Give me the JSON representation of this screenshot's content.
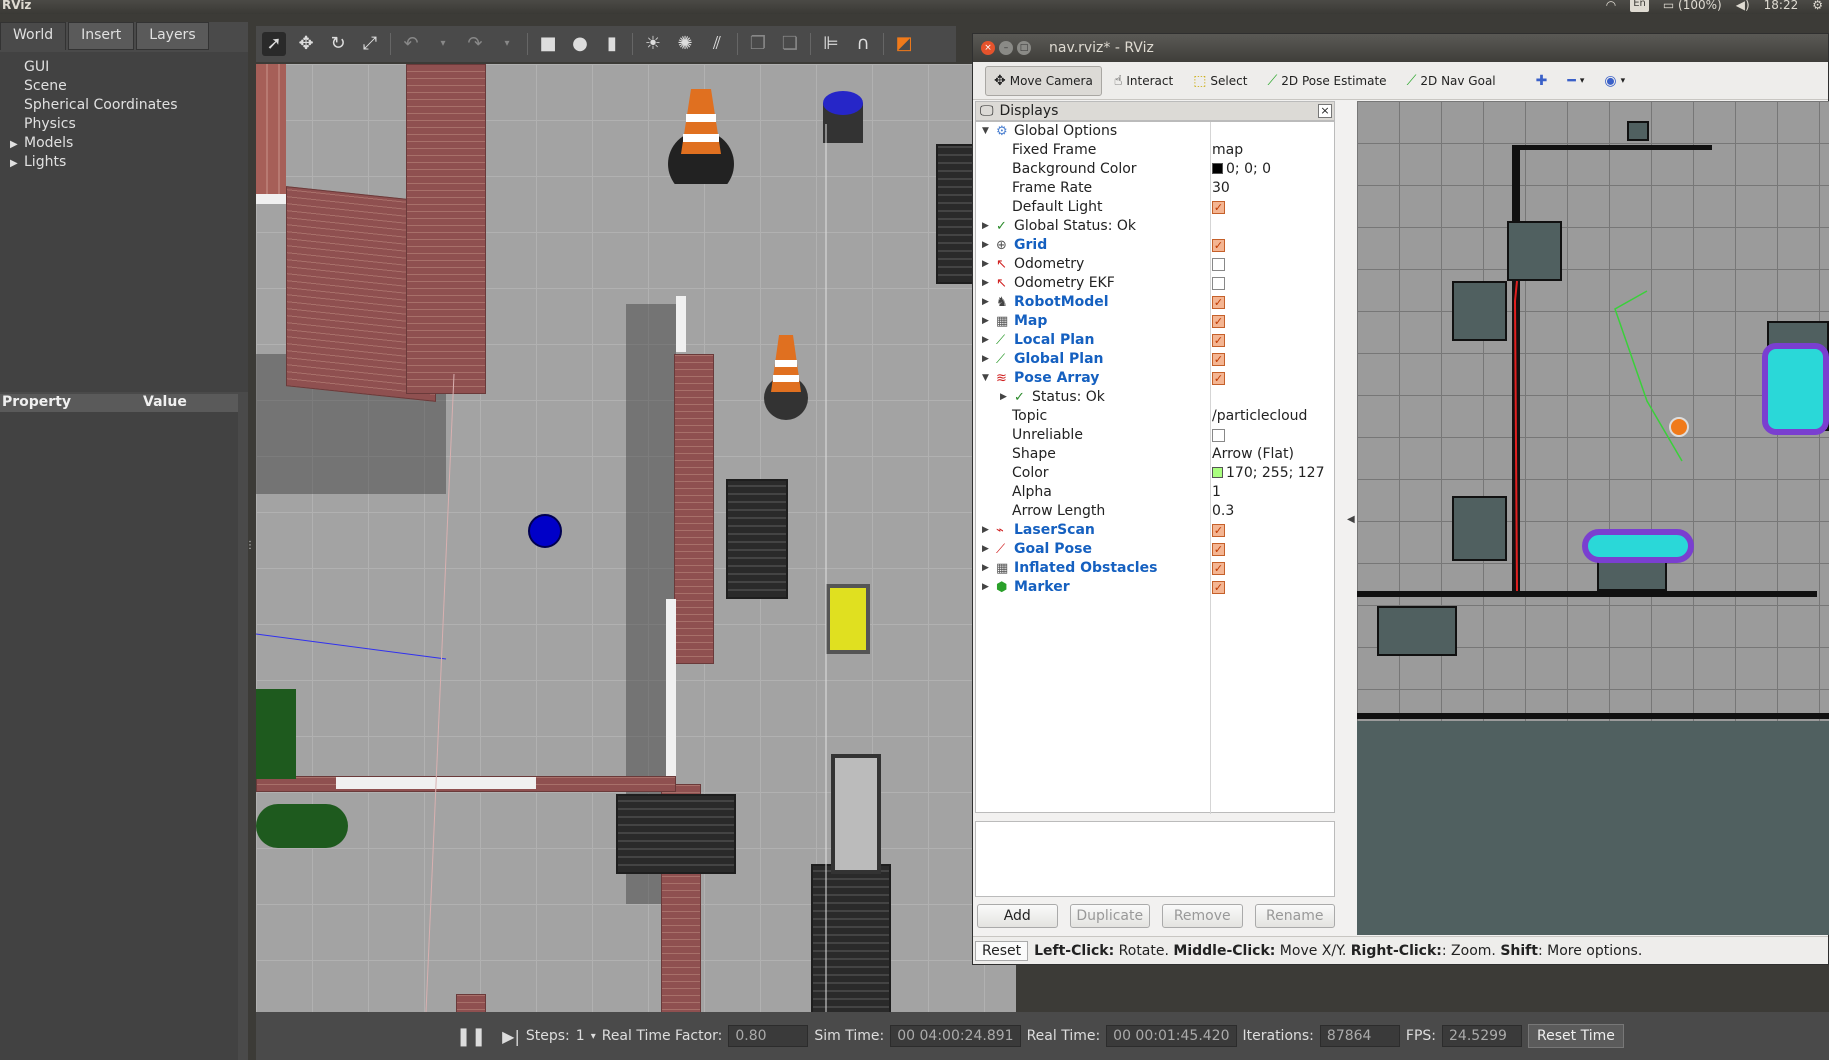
{
  "topbar": {
    "app_name": "RViz",
    "keyboard": "En",
    "battery": "(100%)",
    "clock": "18:22"
  },
  "gazebo": {
    "tabs": [
      "World",
      "Insert",
      "Layers"
    ],
    "world_items": [
      {
        "label": "GUI",
        "expandable": false
      },
      {
        "label": "Scene",
        "expandable": false
      },
      {
        "label": "Spherical Coordinates",
        "expandable": false
      },
      {
        "label": "Physics",
        "expandable": false
      },
      {
        "label": "Models",
        "expandable": true
      },
      {
        "label": "Lights",
        "expandable": true
      }
    ],
    "property_header": "Property",
    "value_header": "Value",
    "bottom": {
      "steps_label": "Steps:",
      "steps_value": "1",
      "rtf_label": "Real Time Factor:",
      "rtf_value": "0.80",
      "sim_label": "Sim Time:",
      "sim_value": "00 04:00:24.891",
      "real_label": "Real Time:",
      "real_value": "00 00:01:45.420",
      "iter_label": "Iterations:",
      "iter_value": "87864",
      "fps_label": "FPS:",
      "fps_value": "24.5299",
      "reset_time": "Reset Time"
    }
  },
  "rviz": {
    "title": "nav.rviz* - RViz",
    "toolbar": {
      "move_camera": "Move Camera",
      "interact": "Interact",
      "select": "Select",
      "pose_estimate": "2D Pose Estimate",
      "nav_goal": "2D Nav Goal"
    },
    "displays_title": "Displays",
    "rows": [
      {
        "label": "Global Options",
        "indent": 0,
        "tri": "▼",
        "icon": "⚙",
        "icon_color": "#4a7fd0",
        "value": "",
        "bold": false
      },
      {
        "label": "Fixed Frame",
        "indent": 1,
        "tri": "",
        "icon": "",
        "value": "map",
        "bold": false
      },
      {
        "label": "Background Color",
        "indent": 1,
        "tri": "",
        "icon": "",
        "value": "0; 0; 0",
        "swatch": "#000000",
        "bold": false
      },
      {
        "label": "Frame Rate",
        "indent": 1,
        "tri": "",
        "icon": "",
        "value": "30",
        "bold": false
      },
      {
        "label": "Default Light",
        "indent": 1,
        "tri": "",
        "icon": "",
        "check": true,
        "bold": false
      },
      {
        "label": "Global Status: Ok",
        "indent": 0,
        "tri": "▶",
        "icon": "✓",
        "icon_color": "#2a8a2a",
        "value": "",
        "bold": false
      },
      {
        "label": "Grid",
        "indent": 0,
        "tri": "▶",
        "icon": "⊕",
        "icon_color": "#555",
        "check": true,
        "bold": true
      },
      {
        "label": "Odometry",
        "indent": 0,
        "tri": "▶",
        "icon": "↖",
        "icon_color": "#d02020",
        "check": false,
        "bold": false
      },
      {
        "label": "Odometry EKF",
        "indent": 0,
        "tri": "▶",
        "icon": "↖",
        "icon_color": "#d02020",
        "check": false,
        "bold": false
      },
      {
        "label": "RobotModel",
        "indent": 0,
        "tri": "▶",
        "icon": "♞",
        "icon_color": "#444",
        "check": true,
        "bold": true
      },
      {
        "label": "Map",
        "indent": 0,
        "tri": "▶",
        "icon": "▦",
        "icon_color": "#555",
        "check": true,
        "bold": true
      },
      {
        "label": "Local Plan",
        "indent": 0,
        "tri": "▶",
        "icon": "⟋",
        "icon_color": "#2a9a2a",
        "check": true,
        "bold": true
      },
      {
        "label": "Global Plan",
        "indent": 0,
        "tri": "▶",
        "icon": "⟋",
        "icon_color": "#2a9a2a",
        "check": true,
        "bold": true
      },
      {
        "label": "Pose Array",
        "indent": 0,
        "tri": "▼",
        "icon": "≋",
        "icon_color": "#d02020",
        "check": true,
        "bold": true
      },
      {
        "label": "Status: Ok",
        "indent": 1,
        "tri": "▶",
        "icon": "✓",
        "icon_color": "#2a8a2a",
        "value": "",
        "bold": false
      },
      {
        "label": "Topic",
        "indent": 1,
        "tri": "",
        "icon": "",
        "value": "/particlecloud",
        "bold": false
      },
      {
        "label": "Unreliable",
        "indent": 1,
        "tri": "",
        "icon": "",
        "check": false,
        "bold": false
      },
      {
        "label": "Shape",
        "indent": 1,
        "tri": "",
        "icon": "",
        "value": "Arrow (Flat)",
        "bold": false
      },
      {
        "label": "Color",
        "indent": 1,
        "tri": "",
        "icon": "",
        "value": "170; 255; 127",
        "swatch": "#aaff7f",
        "bold": false
      },
      {
        "label": "Alpha",
        "indent": 1,
        "tri": "",
        "icon": "",
        "value": "1",
        "bold": false
      },
      {
        "label": "Arrow Length",
        "indent": 1,
        "tri": "",
        "icon": "",
        "value": "0.3",
        "bold": false
      },
      {
        "label": "LaserScan",
        "indent": 0,
        "tri": "▶",
        "icon": "⌁",
        "icon_color": "#d02020",
        "check": true,
        "bold": true
      },
      {
        "label": "Goal Pose",
        "indent": 0,
        "tri": "▶",
        "icon": "⟋",
        "icon_color": "#d02020",
        "check": true,
        "bold": true
      },
      {
        "label": "Inflated Obstacles",
        "indent": 0,
        "tri": "▶",
        "icon": "▦",
        "icon_color": "#555",
        "check": true,
        "bold": true
      },
      {
        "label": "Marker",
        "indent": 0,
        "tri": "▶",
        "icon": "⬢",
        "icon_color": "#2aa02a",
        "check": true,
        "bold": true
      }
    ],
    "buttons": [
      "Add",
      "Duplicate",
      "Remove",
      "Rename"
    ],
    "status": {
      "reset": "Reset",
      "help_html": [
        {
          "b": "Left-Click:",
          "t": " Rotate. "
        },
        {
          "b": "Middle-Click:",
          "t": " Move X/Y. "
        },
        {
          "b": "Right-Click:",
          "t": ": Zoom. "
        },
        {
          "b": "Shift",
          "t": ": More options."
        }
      ]
    }
  }
}
